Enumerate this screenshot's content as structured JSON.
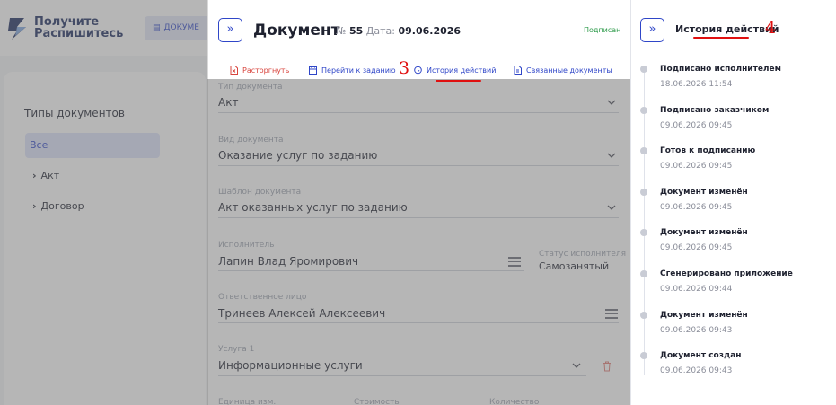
{
  "app": {
    "logo_text": [
      "Получите",
      "Распишитесь"
    ],
    "documents_chip": "ДОКУМЕ",
    "types_title": "Типы документов",
    "types": [
      {
        "label": "Все",
        "selected": true
      },
      {
        "label": "Акт",
        "selected": false
      },
      {
        "label": "Договор",
        "selected": false
      }
    ]
  },
  "document": {
    "title": "Документ",
    "number_label": "№",
    "number": "55",
    "date_label": "Дата:",
    "date": "09.06.2026",
    "status": "Подписан",
    "actions": [
      {
        "label": "Расторгнуть",
        "icon": "file-cancel-icon",
        "color": "#d8443d"
      },
      {
        "label": "Перейти к заданию",
        "icon": "calendar-icon",
        "color": "#2f46c8"
      },
      {
        "label": "История действий",
        "icon": "clock-icon",
        "color": "#2f46c8"
      },
      {
        "label": "Связанные документы",
        "icon": "linked-docs-icon",
        "color": "#2f46c8"
      }
    ],
    "fields": {
      "doc_type": {
        "label": "Тип документа",
        "value": "Акт"
      },
      "doc_kind": {
        "label": "Вид документа",
        "value": "Оказание услуг по заданию"
      },
      "template": {
        "label": "Шаблон документа",
        "value": "Акт оказанных услуг по заданию"
      },
      "executor": {
        "label": "Исполнитель",
        "value": "Лапин Влад Яромирович"
      },
      "executor_status": {
        "label": "Статус исполнителя",
        "value": "Самозанятый"
      },
      "responsible": {
        "label": "Ответственное лицо",
        "value": "Тринеев Алексей Алексеевич"
      },
      "service": {
        "label": "Услуга 1",
        "value": "Информационные услуги"
      },
      "unit_label": "Единица изм.",
      "cost_label": "Стоимость",
      "qty_label": "Количество"
    }
  },
  "history": {
    "title": "История действий",
    "events": [
      {
        "event": "Подписано исполнителем",
        "date": "18.06.2026 11:54"
      },
      {
        "event": "Подписано заказчиком",
        "date": "09.06.2026 09:45"
      },
      {
        "event": "Готов к подписанию",
        "date": "09.06.2026 09:45"
      },
      {
        "event": "Документ изменён",
        "date": "09.06.2026 09:45"
      },
      {
        "event": "Документ изменён",
        "date": "09.06.2026 09:45"
      },
      {
        "event": "Сгенерировано приложение",
        "date": "09.06.2026 09:44"
      },
      {
        "event": "Документ изменён",
        "date": "09.06.2026 09:43"
      },
      {
        "event": "Документ создан",
        "date": "09.06.2026 09:43"
      }
    ]
  },
  "annotations": {
    "step3": "3",
    "step4": "4"
  },
  "colors": {
    "accent": "#2f46c8",
    "danger": "#d8443d",
    "success": "#2e9b4b",
    "annotation": "#e01010"
  }
}
